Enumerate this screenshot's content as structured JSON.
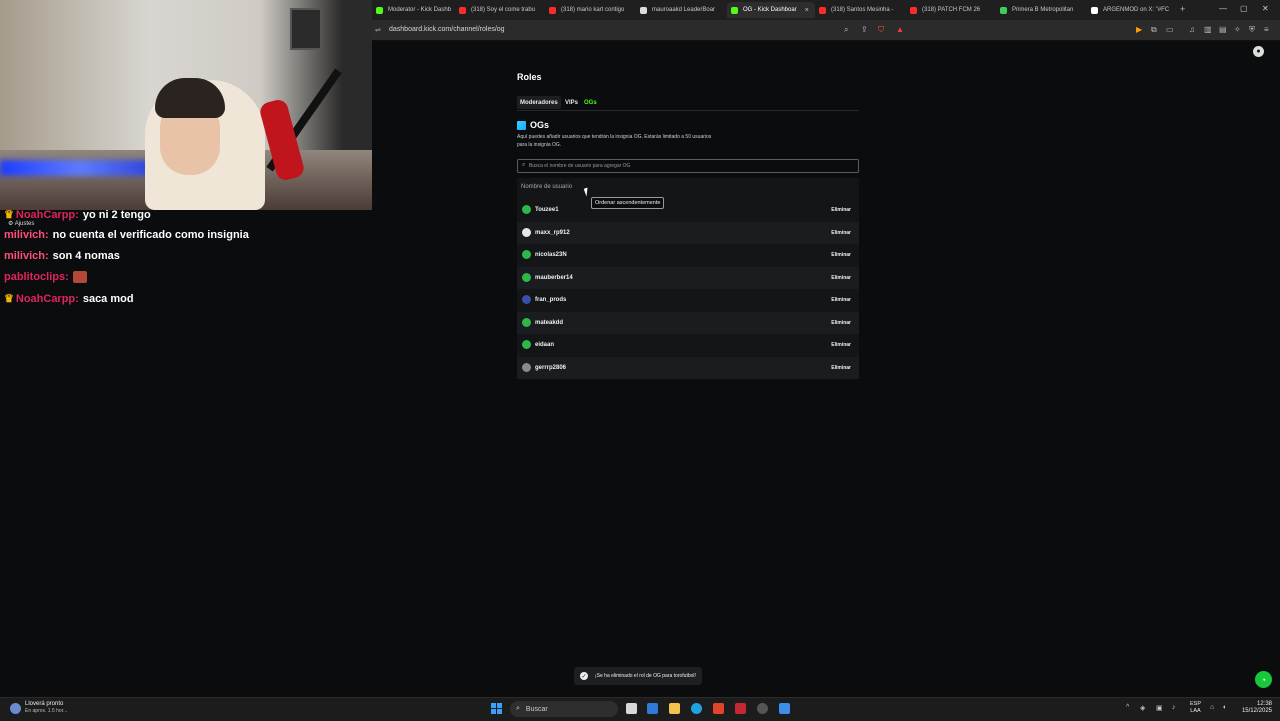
{
  "browser": {
    "tabs": [
      {
        "title": "Moderator - Kick Dashb",
        "color": "#53fc18"
      },
      {
        "title": "(318) Soy el come trabu",
        "color": "#ff2b2b"
      },
      {
        "title": "(318) mario kart contigo",
        "color": "#ff2b2b"
      },
      {
        "title": "mauroaakd LeaderBoar",
        "color": "#dddddd"
      },
      {
        "title": "OG - Kick Dashboar",
        "color": "#53fc18",
        "active": true
      },
      {
        "title": "(318) Santos Mesinha -",
        "color": "#ff2b2b"
      },
      {
        "title": "(318) PATCH FCM 26",
        "color": "#ff2b2b"
      },
      {
        "title": "Primera B Metropolitan",
        "color": "#3ccf5a"
      },
      {
        "title": "ARGENMOD on X: \"#FC",
        "color": "#ffffff"
      }
    ],
    "close_glyph": "×",
    "new_tab_glyph": "+",
    "url": "dashboard.kick.com/channel/roles/og"
  },
  "page": {
    "title": "Roles",
    "tabs": {
      "moderators": "Moderadores",
      "vips": "VIPs",
      "ogs": "OGs"
    },
    "section_title": "OGs",
    "description": "Aquí puedes añadir usuarios que tendrán la insignia OG. Estarás limitado a 50 usuarios para la insignia OG.",
    "search_placeholder": "Busca el nombre de usuario para agregar OG",
    "column_header": "Nombre de usuario",
    "tooltip": "Ordenar ascendentemente",
    "delete_label": "Eliminar",
    "users": [
      {
        "name": "Touzee1",
        "avatar_color": "#2fb84a"
      },
      {
        "name": "maxx_rp912",
        "avatar_color": "#e6e6e6"
      },
      {
        "name": "nicolas23N",
        "avatar_color": "#2fb84a"
      },
      {
        "name": "mauberber14",
        "avatar_color": "#2fb84a"
      },
      {
        "name": "fran_prods",
        "avatar_color": "#3a4fa8"
      },
      {
        "name": "mateakdd",
        "avatar_color": "#2fb84a"
      },
      {
        "name": "eidaan",
        "avatar_color": "#2fb84a"
      },
      {
        "name": "gerrrp2806",
        "avatar_color": "#8a8a8a"
      }
    ],
    "toast": "¡Se ha eliminado el rol de OG para torofutbol!"
  },
  "chat": {
    "ajustes": "Ajustes",
    "messages": [
      {
        "user": "NoahCarpp:",
        "text": "yo ni 2 tengo",
        "color": "#e0245e",
        "crown": true
      },
      {
        "user": "milivich:",
        "text": "no cuenta el verificado como insignia",
        "color": "#ff4f7b",
        "crown": false
      },
      {
        "user": "milivich:",
        "text": "son 4 nomas",
        "color": "#ff4f7b",
        "crown": false
      },
      {
        "user": "pablitoclips:",
        "text": "",
        "color": "#e0245e",
        "crown": false,
        "emote": true
      },
      {
        "user": "NoahCarpp:",
        "text": "saca mod",
        "color": "#e0245e",
        "crown": true
      }
    ]
  },
  "taskbar": {
    "weather_title": "Lloverá pronto",
    "weather_sub": "En aprox. 1.5 hor...",
    "search": "Buscar",
    "lang1": "ESP",
    "lang2": "LAA",
    "time": "12:38",
    "date": "15/12/2025"
  },
  "colors": {
    "accent": "#53fc18",
    "background": "#0b0c0d"
  }
}
